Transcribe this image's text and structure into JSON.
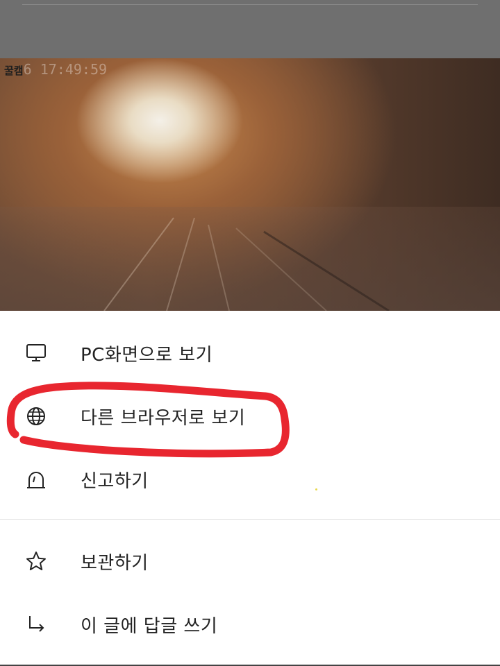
{
  "background": {
    "camera_overlay": {
      "tag": "꿀캠",
      "time": "6 17:49:59"
    }
  },
  "menu": {
    "items": [
      {
        "label": "PC화면으로 보기",
        "icon": "monitor-icon"
      },
      {
        "label": "다른 브라우저로 보기",
        "icon": "globe-icon"
      },
      {
        "label": "신고하기",
        "icon": "report-icon"
      },
      {
        "label": "보관하기",
        "icon": "star-icon"
      },
      {
        "label": "이 글에 답글 쓰기",
        "icon": "reply-arrow-icon"
      }
    ]
  },
  "colors": {
    "annotation": "#e8262f",
    "text": "#222222",
    "dim": "#6f6f6f"
  }
}
